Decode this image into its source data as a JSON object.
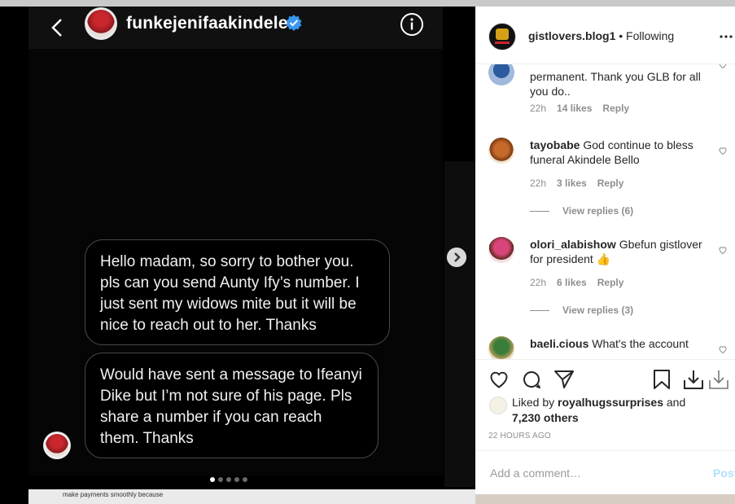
{
  "story": {
    "username": "funkejenifaakindele",
    "messages": [
      "Hello madam, so sorry to bother you. pls can you send Aunty Ify’s number. I just sent my widows mite but it will be nice to reach out to her. Thanks",
      "Would have sent a message to Ifeanyi Dike but I’m not sure of his page. Pls share a number if you can reach them. Thanks"
    ],
    "page_indicator": {
      "current": 1,
      "total": 5
    },
    "bottom_fragment": "make payments smoothly because"
  },
  "post": {
    "author": "gistlovers.blog1",
    "separator": "•",
    "follow_status": "Following",
    "comments": [
      {
        "username": "",
        "text": "permanent. Thank you GLB for all you do..",
        "time": "22h",
        "likes": "14 likes",
        "reply": "Reply"
      },
      {
        "username": "tayobabe",
        "text": "God continue to bless funeral Akindele Bello",
        "time": "22h",
        "likes": "3 likes",
        "reply": "Reply",
        "view_replies": "View replies (6)"
      },
      {
        "username": "olori_alabishow",
        "text": "Gbefun gistlover for president 👍",
        "time": "22h",
        "likes": "6 likes",
        "reply": "Reply",
        "view_replies": "View replies (3)"
      },
      {
        "username": "baeli.cious",
        "text": "What's the account"
      }
    ],
    "liked_by": {
      "prefix": "Liked by",
      "user": "royalhugssurprises",
      "and": "and",
      "others": "7,230 others"
    },
    "timestamp": "22 HOURS AGO",
    "add_comment_placeholder": "Add a comment…",
    "post_button": "Post"
  }
}
